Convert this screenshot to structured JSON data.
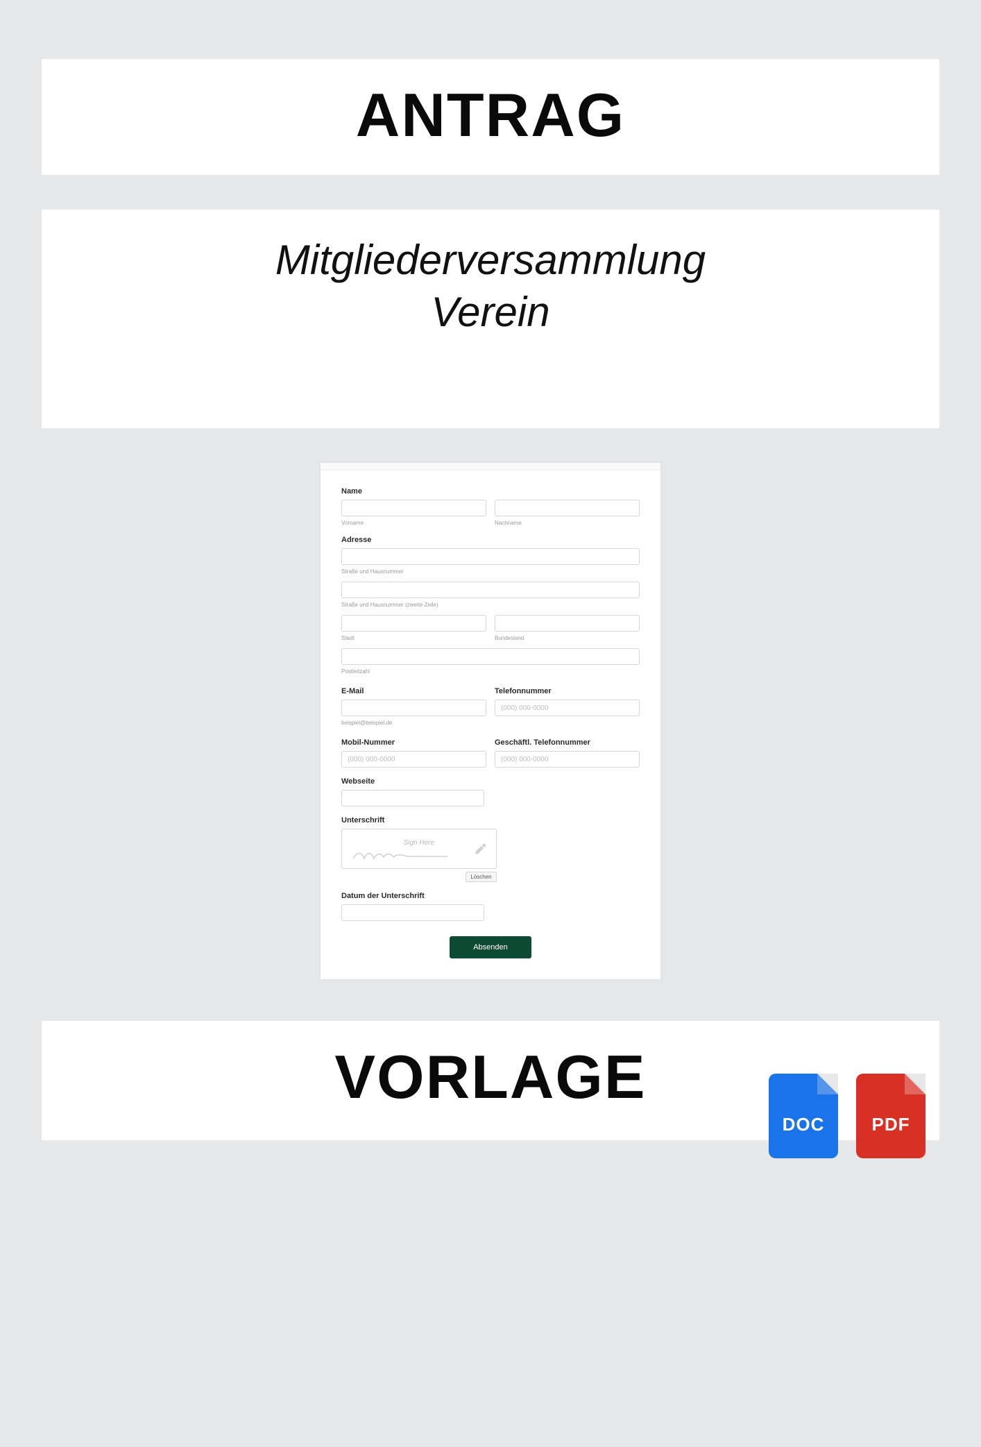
{
  "header": {
    "title": "ANTRAG"
  },
  "subtitle": {
    "line1": "Mitgliederversammlung",
    "line2": "Verein"
  },
  "form": {
    "name_label": "Name",
    "vorname_sub": "Vorname",
    "nachname_sub": "Nachname",
    "adresse_label": "Adresse",
    "strasse_sub": "Straße und Hausnummer",
    "strasse2_sub": "Straße und Hausnummer (zweite Zeile)",
    "stadt_sub": "Stadt",
    "bundesland_sub": "Bundesland",
    "plz_sub": "Postleitzahl",
    "email_label": "E-Mail",
    "email_sub": "beispiel@beispiel.de",
    "telefon_label": "Telefonnummer",
    "telefon_placeholder": "(000) 000-0000",
    "mobil_label": "Mobil-Nummer",
    "mobil_placeholder": "(000) 000-0000",
    "geschaeft_label": "Geschäftl. Telefonnummer",
    "geschaeft_placeholder": "(000) 000-0000",
    "webseite_label": "Webseite",
    "unterschrift_label": "Unterschrift",
    "sign_here": "Sign Here",
    "loeschen": "Löschen",
    "datum_label": "Datum der Unterschrift",
    "absenden": "Absenden"
  },
  "files": {
    "doc": "DOC",
    "pdf": "PDF"
  },
  "footer": {
    "title": "VORLAGE"
  }
}
